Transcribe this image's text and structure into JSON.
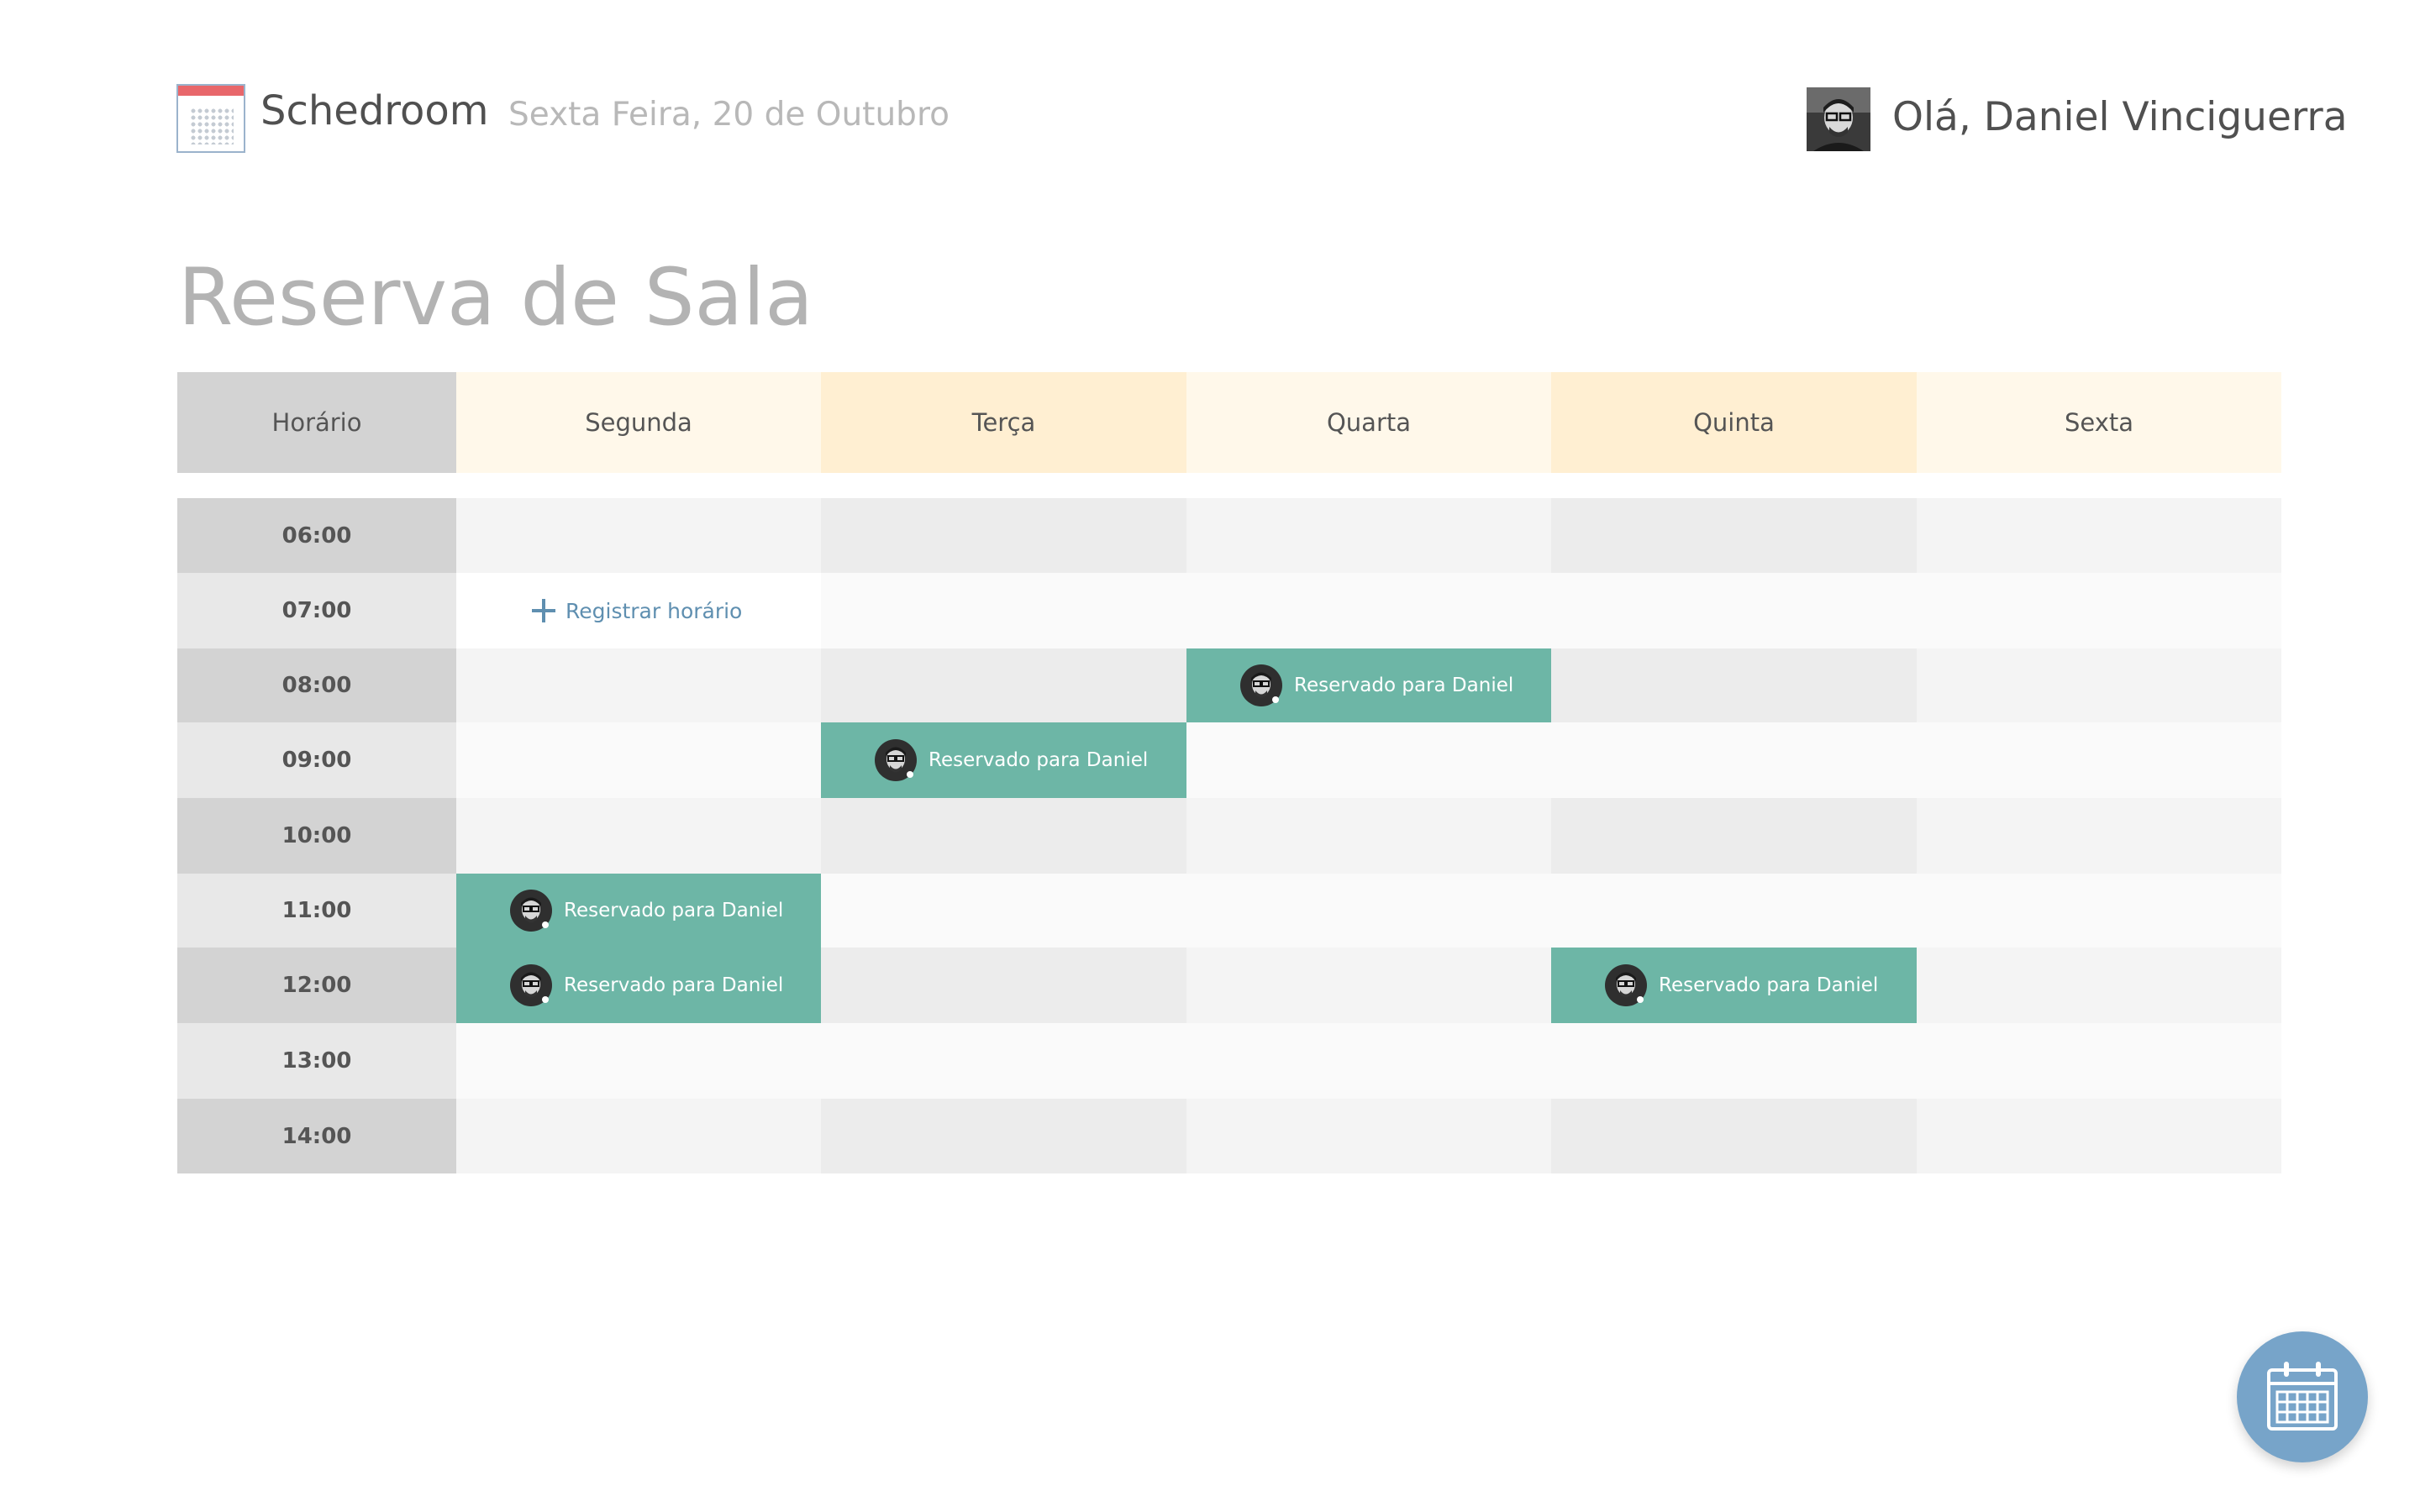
{
  "header": {
    "app_title": "Schedroom",
    "date": "Sexta Feira, 20 de Outubro",
    "greeting": "Olá, Daniel Vinciguerra"
  },
  "page": {
    "title": "Reserva de Sala"
  },
  "schedule": {
    "time_header": "Horário",
    "days": [
      "Segunda",
      "Terça",
      "Quarta",
      "Quinta",
      "Sexta"
    ],
    "times": [
      "06:00",
      "07:00",
      "08:00",
      "09:00",
      "10:00",
      "11:00",
      "12:00",
      "13:00",
      "14:00"
    ],
    "register_label": "Registrar horário",
    "bookings": [
      {
        "day": "Quarta",
        "time": "08:00",
        "label": "Reservado para Daniel"
      },
      {
        "day": "Terça",
        "time": "09:00",
        "label": "Reservado para Daniel"
      },
      {
        "day": "Segunda",
        "time": "11:00",
        "label": "Reservado para Daniel"
      },
      {
        "day": "Segunda",
        "time": "12:00",
        "label": "Reservado para Daniel"
      },
      {
        "day": "Quinta",
        "time": "12:00",
        "label": "Reservado para Daniel"
      }
    ]
  },
  "colors": {
    "booking": "#6db6a6",
    "accent": "#5f8fb0",
    "fab": "#77a4c9",
    "header_light": "#fff8ea",
    "header_dark": "#ffefd2"
  },
  "icons": {
    "logo": "calendar-logo-icon",
    "fab": "calendar-icon",
    "register": "plus-icon"
  }
}
